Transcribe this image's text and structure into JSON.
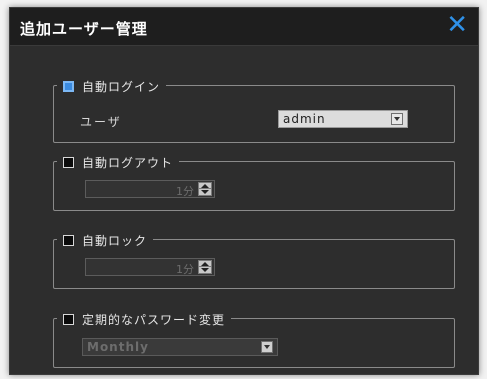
{
  "dialog": {
    "title": "追加ユーザー管理",
    "close_icon": "close-x-icon",
    "accent_color": "#2f91e8"
  },
  "auto_login": {
    "label": "自動ログイン",
    "checked": true,
    "user_label": "ユーザ",
    "user_value": "admin"
  },
  "auto_logout": {
    "label": "自動ログアウト",
    "checked": false,
    "value": "1分"
  },
  "auto_lock": {
    "label": "自動ロック",
    "checked": false,
    "value": "1分"
  },
  "password_change": {
    "label": "定期的なパスワード変更",
    "checked": false,
    "value": "Monthly"
  }
}
